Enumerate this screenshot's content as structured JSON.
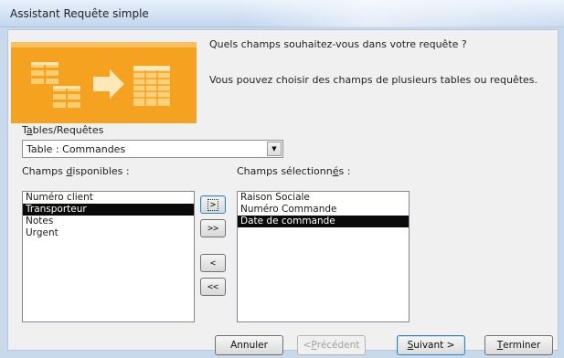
{
  "window": {
    "title": "Assistant Requête simple"
  },
  "header": {
    "question": "Quels champs souhaitez-vous dans votre requête ?",
    "hint": "Vous pouvez choisir des champs de plusieurs tables ou requêtes."
  },
  "source": {
    "label_pre": "T",
    "label_accel": "a",
    "label_post": "bles/Requêtes",
    "value": "Table : Commandes"
  },
  "available": {
    "label_pre": "Champs ",
    "label_accel": "d",
    "label_post": "isponibles :",
    "items": [
      "Numéro client",
      "Transporteur",
      "Notes",
      "Urgent"
    ],
    "selected_index": 1
  },
  "chosen": {
    "label_pre": "Champs sélectionn",
    "label_accel": "é",
    "label_post": "s :",
    "items": [
      "Raison Sociale",
      "Numéro Commande",
      "Date de commande"
    ],
    "selected_index": 2
  },
  "move_buttons": {
    "add_one": ">",
    "add_all": ">>",
    "remove_one": "<",
    "remove_all": "<<"
  },
  "footer": {
    "cancel": "Annuler",
    "back_pre": "< ",
    "back_accel": "P",
    "back_post": "récédent",
    "next_accel": "S",
    "next_post": "uivant >",
    "finish_accel": "T",
    "finish_post": "erminer"
  },
  "colors": {
    "banner_orange": "#f5a623",
    "selection": "#0a0a0a"
  }
}
